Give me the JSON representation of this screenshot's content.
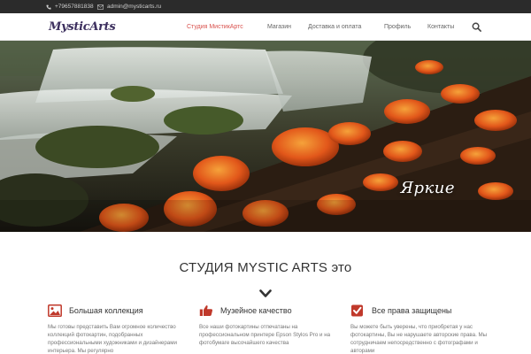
{
  "topbar": {
    "phone": "+79657881838",
    "email": "admin@mysticarts.ru",
    "phone_icon": "phone-icon",
    "email_icon": "envelope-icon"
  },
  "header": {
    "logo_text": "MysticArts",
    "nav": [
      {
        "label": "Студия МистикАртс",
        "active": true
      },
      {
        "label": "Магазин",
        "active": false
      },
      {
        "label": "Доставка и оплата",
        "active": false
      },
      {
        "label": "Профиль",
        "active": false
      },
      {
        "label": "Контакты",
        "active": false
      }
    ],
    "search_icon": "search-icon",
    "accent_color": "#d9534f"
  },
  "hero": {
    "caption": "Яркие"
  },
  "section": {
    "title": "СТУДИЯ MYSTIC ARTS это",
    "chevron_icon": "chevron-down-icon",
    "features": [
      {
        "icon": "picture-icon",
        "title": "Большая коллекция",
        "text": "Мы готовы представить Вам огромное количество коллекций фотокартин, подобранных профессиональными художниками и дизайнерами интерьера. Мы регулярно"
      },
      {
        "icon": "thumbs-up-icon",
        "title": "Музейное качество",
        "text": "Все наши фотокартины отпечатаны на профессиональном принтере Epson Stylos Pro и на фотобумаге высочайшего качества"
      },
      {
        "icon": "check-square-icon",
        "title": "Все права защищены",
        "text": "Вы можете быть уверены, что приобретая у нас фотокартины, Вы не нарушаете авторские права. Мы сотрудничаем непосредственно с фотографами и авторами"
      }
    ],
    "icon_color": "#c0392b"
  }
}
